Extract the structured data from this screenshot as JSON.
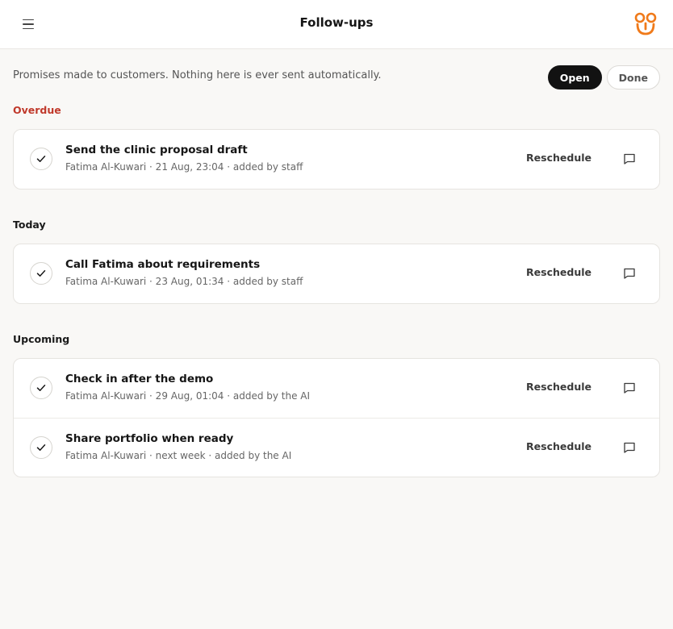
{
  "header": {
    "title": "Follow-ups",
    "menu_icon": "hamburger-menu-icon",
    "logo_icon": "brand-logo-icon",
    "accent_color": "#f07a1a"
  },
  "intro": {
    "text": "Promises made to customers. Nothing here is ever sent automatically."
  },
  "filters": {
    "open_label": "Open",
    "done_label": "Done",
    "selected": "Open"
  },
  "sections": {
    "overdue": {
      "label": "Overdue",
      "color": "#c0392b",
      "items": [
        {
          "title": "Send the clinic proposal draft",
          "meta": "Fatima Al-Kuwari · 21 Aug, 23:04 · added by staff",
          "action": "Reschedule"
        }
      ]
    },
    "today": {
      "label": "Today",
      "items": [
        {
          "title": "Call Fatima about requirements",
          "meta": "Fatima Al-Kuwari · 23 Aug, 01:34 · added by staff",
          "action": "Reschedule"
        }
      ]
    },
    "upcoming": {
      "label": "Upcoming",
      "items": [
        {
          "title": "Check in after the demo",
          "meta": "Fatima Al-Kuwari · 29 Aug, 01:04 · added by the AI",
          "action": "Reschedule"
        },
        {
          "title": "Share portfolio when ready",
          "meta": "Fatima Al-Kuwari · next week · added by the AI",
          "action": "Reschedule"
        }
      ]
    }
  }
}
